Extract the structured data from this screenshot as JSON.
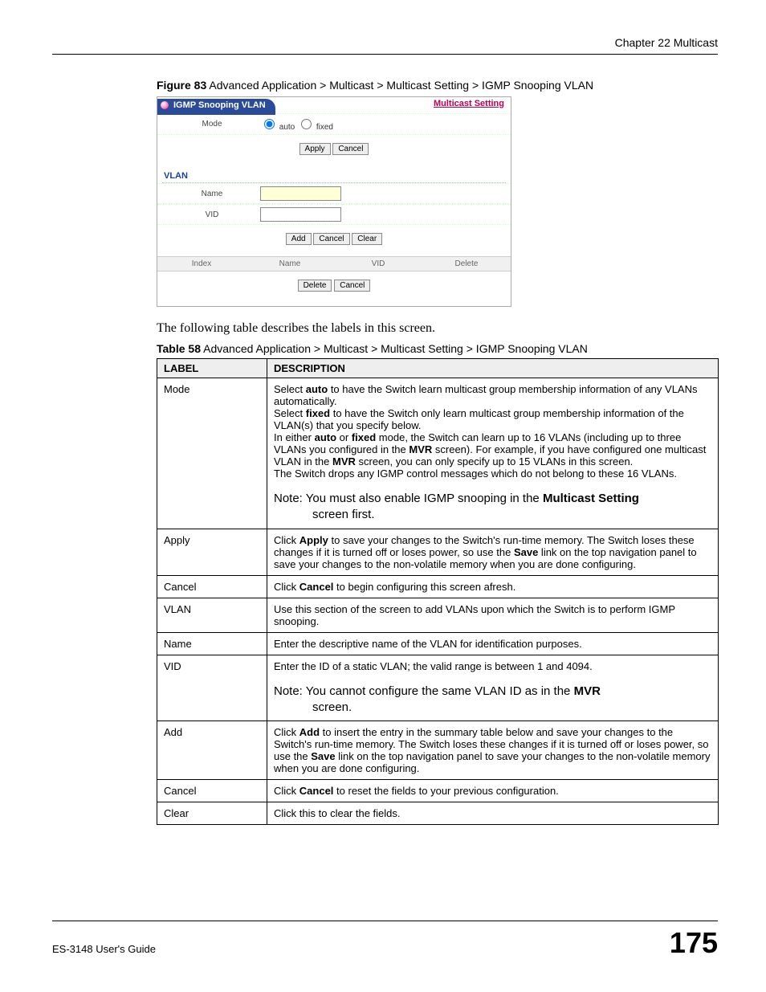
{
  "chapter": "Chapter 22 Multicast",
  "figure_caption_prefix": "Figure 83",
  "figure_caption": "   Advanced Application > Multicast > Multicast Setting > IGMP Snooping VLAN",
  "screenshot": {
    "tab_title": "IGMP Snooping VLAN",
    "link": "Multicast Setting",
    "mode_label": "Mode",
    "mode_auto": "auto",
    "mode_fixed": "fixed",
    "apply": "Apply",
    "cancel": "Cancel",
    "vlan_title": "VLAN",
    "name_label": "Name",
    "vid_label": "VID",
    "add": "Add",
    "clear": "Clear",
    "col_index": "Index",
    "col_name": "Name",
    "col_vid": "VID",
    "col_delete": "Delete",
    "delete": "Delete"
  },
  "intro": "The following table describes the labels in this screen.",
  "table_caption_prefix": "Table 58",
  "table_caption": "   Advanced Application > Multicast > Multicast Setting > IGMP Snooping VLAN",
  "th_label": "LABEL",
  "th_desc": "DESCRIPTION",
  "rows": {
    "mode": {
      "label": "Mode",
      "p1a": "Select ",
      "p1b": "auto",
      "p1c": " to have the Switch learn multicast group membership information of any VLANs automatically.",
      "p2a": "Select ",
      "p2b": "fixed",
      "p2c": " to have the Switch only learn multicast group membership information of the VLAN(s) that you specify below.",
      "p3a": "In either ",
      "p3b": "auto",
      "p3c": " or ",
      "p3d": "fixed",
      "p3e": " mode, the Switch can learn up to 16 VLANs (including up to three VLANs you configured in the ",
      "p3f": "MVR",
      "p3g": " screen). For example, if you have configured one multicast VLAN in the ",
      "p3h": "MVR",
      "p3i": " screen, you can only specify up to 15 VLANs in this screen.",
      "p4": "The Switch drops any IGMP control messages which do not belong to these 16 VLANs.",
      "note1a": "Note: You must also enable IGMP snooping in the ",
      "note1b": "Multicast Setting",
      "note1c": " screen first."
    },
    "apply": {
      "label": "Apply",
      "p1a": "Click ",
      "p1b": "Apply",
      "p1c": " to save your changes to the Switch's run-time memory. The Switch loses these changes if it is turned off or loses power, so use the ",
      "p1d": "Save",
      "p1e": " link on the top navigation panel to save your changes to the non-volatile memory when you are done configuring."
    },
    "cancel": {
      "label": "Cancel",
      "p1a": "Click ",
      "p1b": "Cancel",
      "p1c": " to begin configuring this screen afresh."
    },
    "vlan": {
      "label": "VLAN",
      "p1": "Use this section of the screen to add VLANs upon which the Switch is to perform IGMP snooping."
    },
    "name": {
      "label": "Name",
      "p1": "Enter the descriptive name of the VLAN for identification purposes."
    },
    "vid": {
      "label": "VID",
      "p1": "Enter the ID of a static VLAN; the valid range is between 1 and 4094.",
      "note1a": "Note: You cannot configure the same VLAN ID as in the ",
      "note1b": "MVR",
      "note1c": " screen."
    },
    "add": {
      "label": "Add",
      "p1a": "Click ",
      "p1b": "Add",
      "p1c": " to insert the entry in the summary table below and save your changes to the Switch's run-time memory. The Switch loses these changes if it is turned off or loses power, so use the ",
      "p1d": "Save",
      "p1e": " link on the top navigation panel to save your changes to the non-volatile memory when you are done configuring."
    },
    "cancel2": {
      "label": "Cancel",
      "p1a": "Click ",
      "p1b": "Cancel",
      "p1c": " to reset the fields to your previous configuration."
    },
    "clear": {
      "label": "Clear",
      "p1": "Click this to clear the fields."
    }
  },
  "footer_guide": "ES-3148 User's Guide",
  "page_number": "175"
}
